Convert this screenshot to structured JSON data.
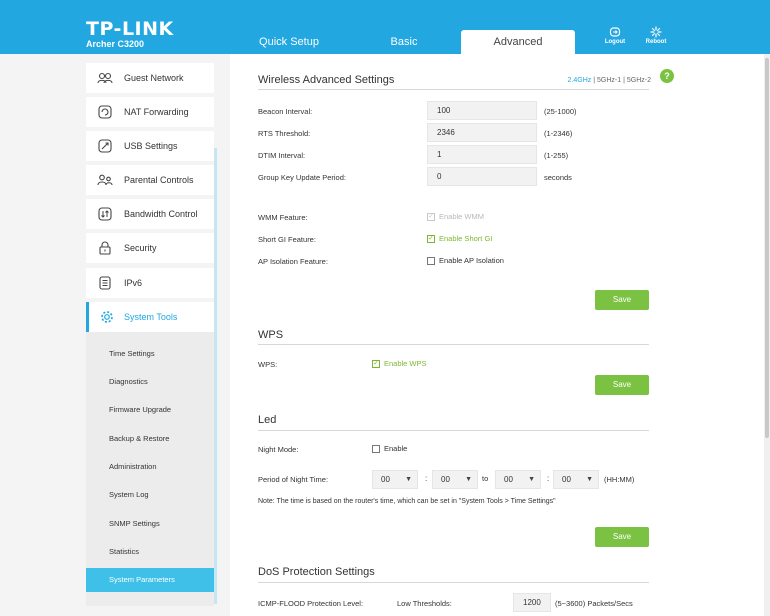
{
  "header": {
    "brand": "TP-LINK",
    "model": "Archer C3200",
    "tabs": [
      "Quick Setup",
      "Basic",
      "Advanced"
    ],
    "logout": "Logout",
    "reboot": "Reboot"
  },
  "sidebar": {
    "items": [
      "Guest Network",
      "NAT Forwarding",
      "USB Settings",
      "Parental Controls",
      "Bandwidth Control",
      "Security",
      "IPv6",
      "System Tools"
    ],
    "submenu": [
      "Time Settings",
      "Diagnostics",
      "Firmware Upgrade",
      "Backup & Restore",
      "Administration",
      "System Log",
      "SNMP Settings",
      "Statistics",
      "System Parameters"
    ]
  },
  "wireless": {
    "title": "Wireless Advanced Settings",
    "bands": [
      "2.4GHz",
      "5GHz-1",
      "5GHz-2"
    ],
    "sep": "|",
    "help": "?",
    "beacon_label": "Beacon Interval:",
    "beacon_value": "100",
    "beacon_range": "(25-1000)",
    "rts_label": "RTS Threshold:",
    "rts_value": "2346",
    "rts_range": "(1-2346)",
    "dtim_label": "DTIM Interval:",
    "dtim_value": "1",
    "dtim_range": "(1-255)",
    "gk_label": "Group Key Update Period:",
    "gk_value": "0",
    "gk_unit": "seconds",
    "wmm_label": "WMM Feature:",
    "wmm_check": "Enable WMM",
    "sgi_label": "Short GI Feature:",
    "sgi_check": "Enable Short GI",
    "ap_label": "AP Isolation Feature:",
    "ap_check": "Enable AP Isolation",
    "save": "Save"
  },
  "wps": {
    "title": "WPS",
    "label": "WPS:",
    "check": "Enable WPS",
    "save": "Save"
  },
  "led": {
    "title": "Led",
    "night_label": "Night Mode:",
    "night_check": "Enable",
    "period_label": "Period of Night Time:",
    "h1": "00",
    "m1": "00",
    "h2": "00",
    "m2": "00",
    "colon": ":",
    "to": "to",
    "format": "(HH:MM)",
    "note": "Note: The time is based on the router's time, which can be set in \"System Tools > Time Settings\"",
    "save": "Save"
  },
  "dos": {
    "title": "DoS Protection Settings",
    "icmp_label": "ICMP-FLOOD Protection Level:",
    "low_label": "Low Thresholds:",
    "low_value": "1200",
    "low_range": "(5~3600) Packets/Secs"
  },
  "checkmark": "✓",
  "arrow": "▼",
  "colors": {
    "accent": "#22a7e0",
    "green": "#7cc242"
  }
}
